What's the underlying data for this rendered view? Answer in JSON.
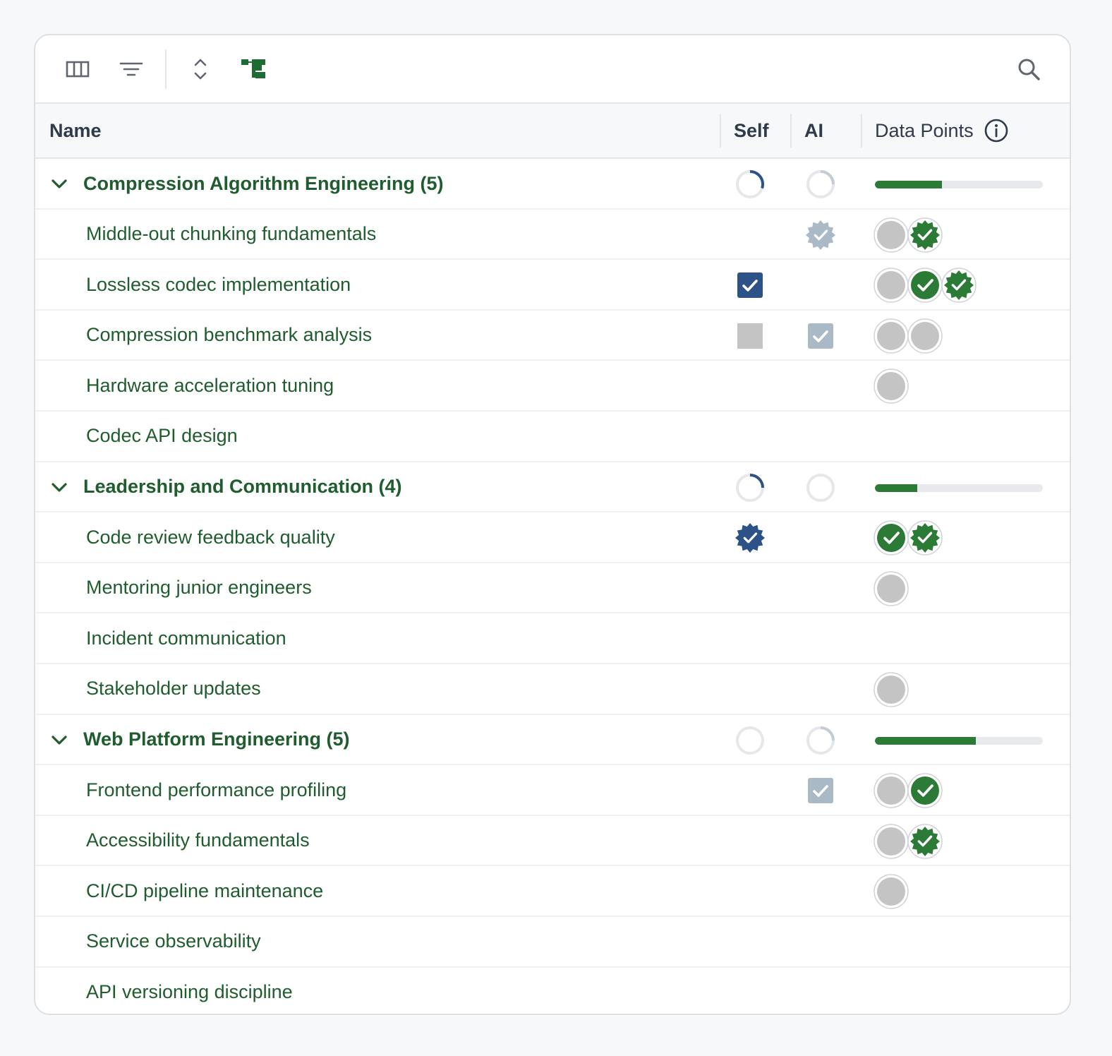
{
  "toolbar": {
    "icons": [
      "columns-icon",
      "filter-icon",
      "expand-collapse-icon",
      "tree-view-icon",
      "search-icon"
    ]
  },
  "header": {
    "name": "Name",
    "self": "Self",
    "ai": "AI",
    "data_points": "Data Points"
  },
  "colors": {
    "accent_green": "#2b7a35",
    "text_green": "#1f5c2e",
    "self_blue": "#2d5287",
    "ai_grey": "#a9b9c6",
    "neutral_grey": "#c4c4c4"
  },
  "groups": [
    {
      "label": "Compression Algorithm Engineering (5)",
      "self_progress": 0.3,
      "ai_progress": 0.25,
      "data_points_progress": 0.4,
      "items": [
        {
          "label": "Middle-out chunking fundamentals",
          "self": "none",
          "ai": "badge-grey",
          "dots": [
            "grey",
            "badge-green"
          ]
        },
        {
          "label": "Lossless codec implementation",
          "self": "checkbox-blue",
          "ai": "none",
          "dots": [
            "grey",
            "check-green",
            "badge-green"
          ]
        },
        {
          "label": "Compression benchmark analysis",
          "self": "square-grey",
          "ai": "checkbox-grey",
          "dots": [
            "grey",
            "grey"
          ]
        },
        {
          "label": "Hardware acceleration tuning",
          "self": "none",
          "ai": "none",
          "dots": [
            "grey"
          ]
        },
        {
          "label": "Codec API design",
          "self": "none",
          "ai": "none",
          "dots": []
        }
      ]
    },
    {
      "label": "Leadership and Communication (4)",
      "self_progress": 0.25,
      "ai_progress": 0.0,
      "data_points_progress": 0.25,
      "items": [
        {
          "label": "Code review feedback quality",
          "self": "badge-blue",
          "ai": "none",
          "dots": [
            "check-green",
            "badge-green"
          ]
        },
        {
          "label": "Mentoring junior engineers",
          "self": "none",
          "ai": "none",
          "dots": [
            "grey"
          ]
        },
        {
          "label": "Incident communication",
          "self": "none",
          "ai": "none",
          "dots": []
        },
        {
          "label": "Stakeholder updates",
          "self": "none",
          "ai": "none",
          "dots": [
            "grey"
          ]
        }
      ]
    },
    {
      "label": "Web Platform Engineering (5)",
      "self_progress": 0.0,
      "ai_progress": 0.25,
      "data_points_progress": 0.6,
      "items": [
        {
          "label": "Frontend performance profiling",
          "self": "none",
          "ai": "checkbox-grey",
          "dots": [
            "grey",
            "check-green"
          ]
        },
        {
          "label": "Accessibility fundamentals",
          "self": "none",
          "ai": "none",
          "dots": [
            "grey",
            "badge-green"
          ]
        },
        {
          "label": "CI/CD pipeline maintenance",
          "self": "none",
          "ai": "none",
          "dots": [
            "grey"
          ]
        },
        {
          "label": "Service observability",
          "self": "none",
          "ai": "none",
          "dots": []
        },
        {
          "label": "API versioning discipline",
          "self": "none",
          "ai": "none",
          "dots": []
        }
      ]
    }
  ]
}
